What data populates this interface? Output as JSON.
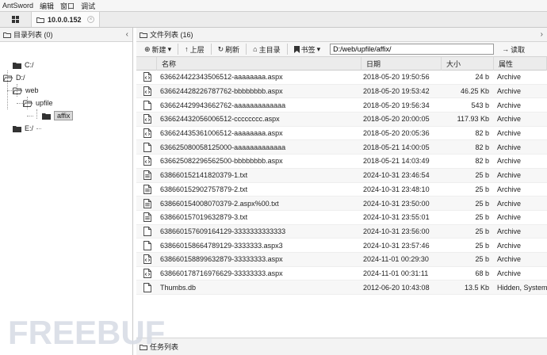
{
  "menu": [
    "AntSword",
    "编辑",
    "窗口",
    "调试"
  ],
  "tab": {
    "label": "10.0.0.152"
  },
  "left_panel": {
    "title": "目录列表 (0)",
    "tree": [
      {
        "label": "C:/"
      },
      {
        "label": "D:/"
      },
      {
        "label": "web"
      },
      {
        "label": "upfile"
      },
      {
        "label": "affix"
      },
      {
        "label": "E:/"
      }
    ]
  },
  "right_panel": {
    "title": "文件列表 (16)",
    "toolbar": {
      "new": "新建",
      "up": "上层",
      "refresh": "刷新",
      "home": "主目录",
      "bookmark": "书签",
      "path": "D:/web/upfile/affix/",
      "read": "读取"
    },
    "columns": [
      "名称",
      "日期",
      "大小",
      "属性"
    ],
    "files": [
      {
        "icon": "code-file-icon",
        "name": "636624422343506512-aaaaaaaa.aspx",
        "date": "2018-05-20 19:50:56",
        "size": "24 b",
        "attr": "Archive"
      },
      {
        "icon": "code-file-icon",
        "name": "636624428226787762-bbbbbbbb.aspx",
        "date": "2018-05-20 19:53:42",
        "size": "46.25 Kb",
        "attr": "Archive"
      },
      {
        "icon": "blank-file-icon",
        "name": "636624429943662762-aaaaaaaaaaaaa",
        "date": "2018-05-20 19:56:34",
        "size": "543 b",
        "attr": "Archive"
      },
      {
        "icon": "code-file-icon",
        "name": "636624432056006512-cccccccc.aspx",
        "date": "2018-05-20 20:00:05",
        "size": "117.93 Kb",
        "attr": "Archive"
      },
      {
        "icon": "code-file-icon",
        "name": "636624435361006512-aaaaaaaa.aspx",
        "date": "2018-05-20 20:05:36",
        "size": "82 b",
        "attr": "Archive"
      },
      {
        "icon": "blank-file-icon",
        "name": "636625080058125000-aaaaaaaaaaaaa",
        "date": "2018-05-21 14:00:05",
        "size": "82 b",
        "attr": "Archive"
      },
      {
        "icon": "code-file-icon",
        "name": "636625082296562500-bbbbbbbb.aspx",
        "date": "2018-05-21 14:03:49",
        "size": "82 b",
        "attr": "Archive"
      },
      {
        "icon": "text-file-icon",
        "name": "638660152141820379-1.txt",
        "date": "2024-10-31 23:46:54",
        "size": "25 b",
        "attr": "Archive"
      },
      {
        "icon": "text-file-icon",
        "name": "638660152902757879-2.txt",
        "date": "2024-10-31 23:48:10",
        "size": "25 b",
        "attr": "Archive"
      },
      {
        "icon": "text-file-icon",
        "name": "638660154008070379-2.aspx%00.txt",
        "date": "2024-10-31 23:50:00",
        "size": "25 b",
        "attr": "Archive"
      },
      {
        "icon": "text-file-icon",
        "name": "638660157019632879-3.txt",
        "date": "2024-10-31 23:55:01",
        "size": "25 b",
        "attr": "Archive"
      },
      {
        "icon": "blank-file-icon",
        "name": "638660157609164129-3333333333333",
        "date": "2024-10-31 23:56:00",
        "size": "25 b",
        "attr": "Archive"
      },
      {
        "icon": "blank-file-icon",
        "name": "638660158664789129-3333333.aspx3",
        "date": "2024-10-31 23:57:46",
        "size": "25 b",
        "attr": "Archive"
      },
      {
        "icon": "code-file-icon",
        "name": "638660158899632879-33333333.aspx",
        "date": "2024-11-01 00:29:30",
        "size": "25 b",
        "attr": "Archive"
      },
      {
        "icon": "code-file-icon",
        "name": "638660178716976629-33333333.aspx",
        "date": "2024-11-01 00:31:11",
        "size": "68 b",
        "attr": "Archive"
      },
      {
        "icon": "blank-file-icon",
        "name": "Thumbs.db",
        "date": "2012-06-20 10:43:08",
        "size": "13.5 Kb",
        "attr": "Hidden, System,"
      }
    ]
  },
  "taskbar": {
    "title": "任务列表"
  },
  "watermark": {
    "text": "FREEBUF"
  },
  "colors": {
    "header_bg": "#f3f3f3",
    "border": "#c8c8c8",
    "watermark": "#d6dbe4"
  }
}
